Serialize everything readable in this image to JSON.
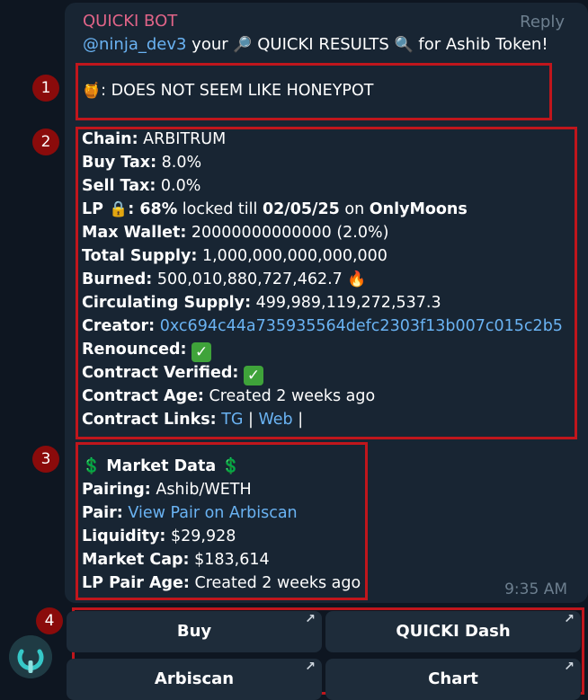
{
  "message": {
    "sender": "QUICKI BOT",
    "reply_label": "Reply",
    "headline_mention": "@ninja_dev3",
    "headline_part1": " your ",
    "headline_part2": " QUICKI RESULTS ",
    "headline_part3": " for Ashib Token!",
    "time": "9:35 AM"
  },
  "honeypot": {
    "text": ": DOES NOT SEEM LIKE HONEYPOT"
  },
  "token_info": {
    "chain_label": "Chain:",
    "chain_value": " ARBITRUM",
    "buy_tax_label": "Buy Tax:",
    "buy_tax_value": " 8.0%",
    "sell_tax_label": "Sell Tax:",
    "sell_tax_value": " 0.0%",
    "lp_label": "LP ",
    "lp_colon": ":",
    "lp_percent": " 68%",
    "lp_locked_text": " locked till ",
    "lp_date": "02/05/25",
    "lp_on": " on ",
    "lp_platform": "OnlyMoons",
    "max_wallet_label": "Max Wallet:",
    "max_wallet_value": " 20000000000000 (2.0%)",
    "total_supply_label": "Total Supply:",
    "total_supply_value": " 1,000,000,000,000,000",
    "burned_label": "Burned:",
    "burned_value": " 500,010,880,727,462.7 ",
    "circ_label": "Circulating Supply:",
    "circ_value": " 499,989,119,272,537.3",
    "creator_label": "Creator:",
    "creator_value": "0xc694c44a735935564defc2303f13b007c015c2b5",
    "renounced_label": "Renounced:",
    "verified_label": "Contract Verified:",
    "age_label": "Contract Age:",
    "age_value": " Created 2 weeks ago",
    "links_label": "Contract Links:",
    "link_tg": "TG",
    "link_sep": " | ",
    "link_web": "Web",
    "link_end": " |"
  },
  "market": {
    "title": " Market Data ",
    "pairing_label": "Pairing:",
    "pairing_value": " Ashib/WETH",
    "pair_label": "Pair:",
    "pair_link": "View Pair on Arbiscan",
    "liquidity_label": "Liquidity:",
    "liquidity_value": " $29,928",
    "mcap_label": "Market Cap:",
    "mcap_value": " $183,614",
    "lp_age_label": "LP Pair Age:",
    "lp_age_value": " Created 2 weeks ago"
  },
  "keyboard": {
    "buy": "Buy",
    "dash": "QUICKI Dash",
    "arbiscan": "Arbiscan",
    "chart": "Chart",
    "arrow": "↗"
  },
  "markers": [
    "1",
    "2",
    "3",
    "4"
  ],
  "icons": {
    "honey": "honey-pot-icon",
    "magnifier": "magnifier-icon",
    "lock": "lock-icon",
    "fire": "fire-icon",
    "dollar": "dollar-icon",
    "check": "check-mark-icon"
  }
}
